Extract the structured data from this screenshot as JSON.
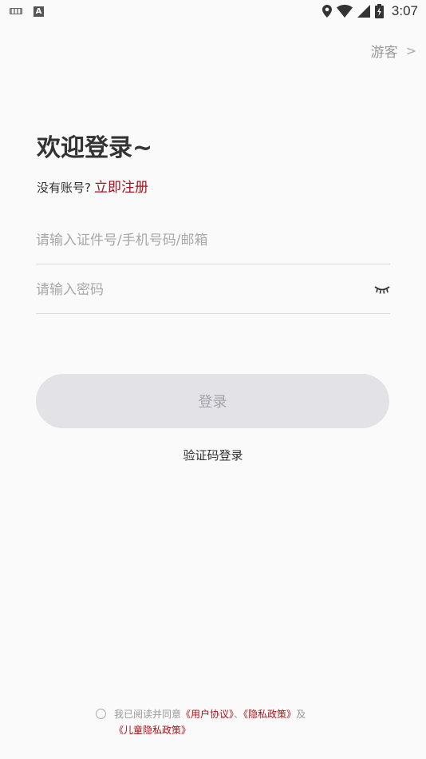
{
  "status_bar": {
    "time": "3:07",
    "left_icons": [
      "keyboard-icon",
      "a-icon"
    ],
    "right_icons": [
      "location-icon",
      "wifi-icon",
      "signal-icon",
      "battery-charging-icon"
    ]
  },
  "header": {
    "guest_label": "游客",
    "guest_chevron": ">"
  },
  "welcome": {
    "title": "欢迎登录~",
    "no_account_text": "没有账号?",
    "register_link": "立即注册"
  },
  "form": {
    "account_placeholder": "请输入证件号/手机号码/邮箱",
    "password_placeholder": "请输入密码",
    "login_button": "登录",
    "sms_login": "验证码登录"
  },
  "agreement": {
    "prefix": "我已阅读并同意",
    "user_agreement": "《用户协议》",
    "separator": "、",
    "privacy_policy": "《隐私政策》",
    "and_text": "及",
    "children_privacy_policy": "《儿童隐私政策》"
  },
  "colors": {
    "accent": "#a6121b",
    "background": "#fafafa",
    "button_disabled_bg": "#e2e2e7",
    "button_disabled_text": "#a3a3ab"
  }
}
